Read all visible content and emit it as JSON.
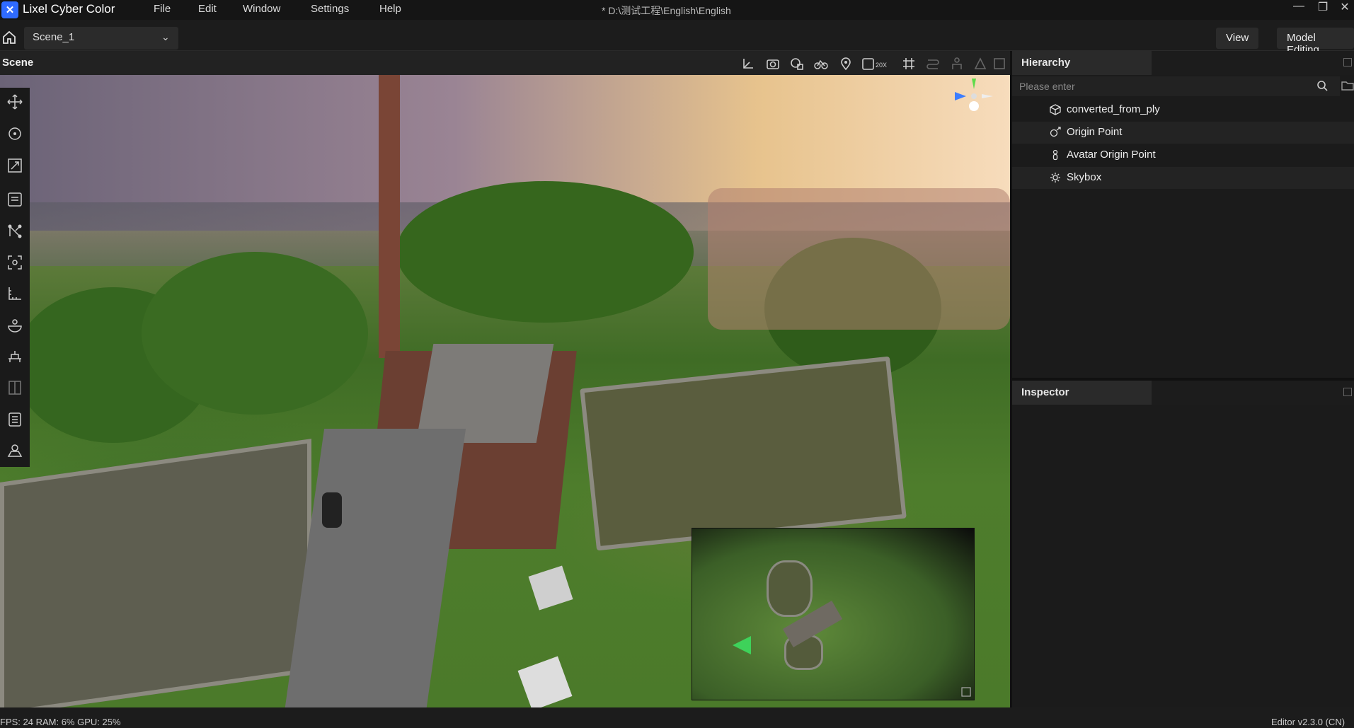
{
  "app": {
    "name": "Lixel Cyber Color",
    "window_title": "* D:\\测试工程\\English\\English"
  },
  "menu": [
    "File",
    "Edit",
    "Window",
    "Settings",
    "Help"
  ],
  "toolbar": {
    "scene_selected": "Scene_1",
    "view_label": "View",
    "model_editing_label": "Model Editing"
  },
  "scene_panel": {
    "title": "Scene",
    "zoom_badge": "20X"
  },
  "hierarchy": {
    "title": "Hierarchy",
    "search_placeholder": "Please enter",
    "items": [
      {
        "label": "converted_from_ply",
        "icon": "cube-icon"
      },
      {
        "label": "Origin Point",
        "icon": "origin-icon"
      },
      {
        "label": "Avatar Origin Point",
        "icon": "avatar-icon"
      },
      {
        "label": "Skybox",
        "icon": "gear-icon"
      }
    ]
  },
  "inspector": {
    "title": "Inspector"
  },
  "status": {
    "stats": "FPS: 24  RAM: 6%  GPU: 25%",
    "version": "Editor v2.3.0 (CN)"
  },
  "colors": {
    "accent": "#2f6bff",
    "background": "#1b1b1b",
    "panel": "#222222"
  }
}
